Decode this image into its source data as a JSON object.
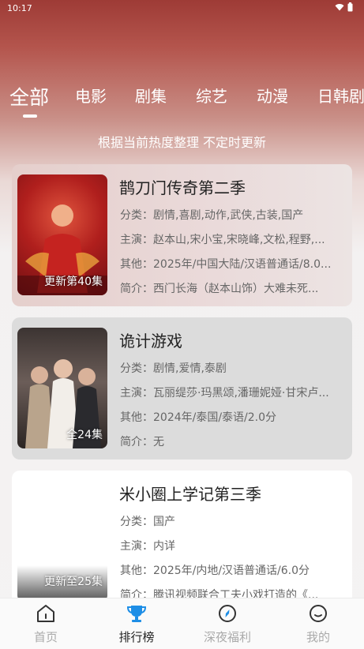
{
  "status": {
    "time": "10:17"
  },
  "tabs": [
    "全部",
    "电影",
    "剧集",
    "综艺",
    "动漫",
    "日韩剧"
  ],
  "subtitle": "根据当前热度整理 不定时更新",
  "cards": [
    {
      "title": "鹊刀门传奇第二季",
      "episode": "更新第40集",
      "category": "分类：剧情,喜剧,动作,武侠,古装,国产",
      "cast": "主演：赵本山,宋小宝,宋晓峰,文松,程野,...",
      "other": "其他：2025年/中国大陆/汉语普通话/8.0...",
      "intro": "简介：西门长海（赵本山饰）大难未死..."
    },
    {
      "title": "诡计游戏",
      "episode": "全24集",
      "category": "分类：剧情,爱情,泰剧",
      "cast": "主演：瓦丽缇莎·玛黑颂,潘珊妮娅·甘宋卢...",
      "other": "其他：2024年/泰国/泰语/2.0分",
      "intro": "简介：无"
    },
    {
      "title": "米小圈上学记第三季",
      "episode": "更新至25集",
      "category": "分类：国产",
      "cast": "主演：内详",
      "other": "其他：2025年/内地/汉语普通话/6.0分",
      "intro": "简介：腾讯视频联合工夫小戏打造的《..."
    }
  ],
  "nav": [
    {
      "label": "首页",
      "icon": "home-icon"
    },
    {
      "label": "排行榜",
      "icon": "trophy-icon"
    },
    {
      "label": "深夜福利",
      "icon": "compass-icon"
    },
    {
      "label": "我的",
      "icon": "smile-icon"
    }
  ],
  "colors": {
    "accent": "#1e8ee6",
    "header": "#a8443d"
  }
}
